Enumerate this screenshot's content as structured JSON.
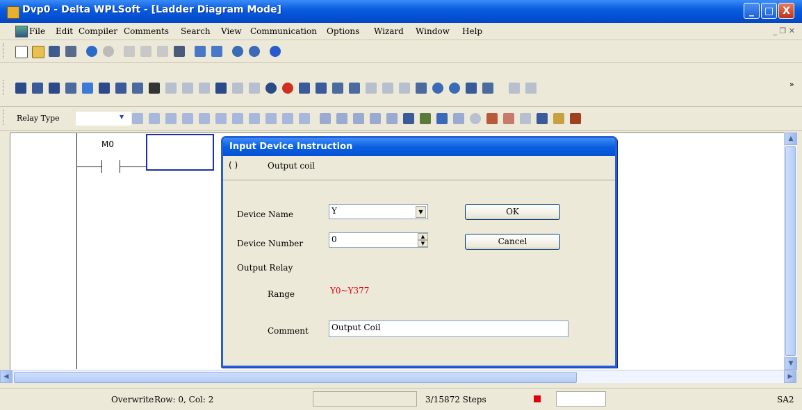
{
  "window": {
    "title": "Dvp0 - Delta WPLSoft - [Ladder Diagram Mode]",
    "minimize_glyph": "_",
    "maximize_glyph": "□",
    "close_glyph": "X"
  },
  "menu": {
    "items": [
      "File",
      "Edit",
      "Compiler",
      "Comments",
      "Search",
      "View",
      "Communication",
      "Options",
      "Wizard",
      "Window",
      "Help"
    ]
  },
  "toolbar3": {
    "relay_type_label": "Relay Type"
  },
  "ladder": {
    "contact_label": "M0"
  },
  "dialog": {
    "title": "Input Device Instruction",
    "instruction_symbol": "( )",
    "instruction_name": "Output coil",
    "device_name_label": "Device Name",
    "device_name_value": "Y",
    "device_number_label": "Device Number",
    "device_number_value": "0",
    "ok_label": "OK",
    "cancel_label": "Cancel",
    "relay_group_label": "Output Relay",
    "range_label": "Range",
    "range_value": "Y0~Y377",
    "range_color": "#e00010",
    "comment_label": "Comment",
    "comment_value": "Output Coil"
  },
  "status": {
    "mode": "Overwrite",
    "position": "Row: 0, Col: 2",
    "steps": "3/15872 Steps",
    "plc_model": "SA2"
  },
  "colors": {
    "titlebar": "#0a5ee0",
    "selection_box": "#1c2ea8"
  }
}
